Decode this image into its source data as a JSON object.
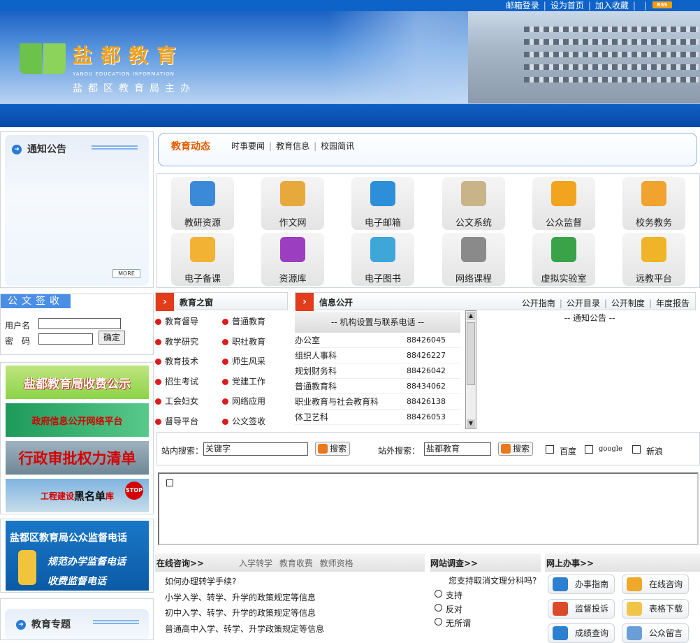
{
  "toplinks": {
    "mail_login": "邮箱登录",
    "set_home": "设为首页",
    "add_fav": "加入收藏",
    "rss": "RSS"
  },
  "header": {
    "title": "盐都教育",
    "subtitle_en": "YANDU EDUCATION INFORMATION",
    "subtitle": "盐都区教育局主办"
  },
  "notice": {
    "title": "通知公告",
    "more": "MORE"
  },
  "doc_receive": {
    "title": "公文签收",
    "username_label": "用户名",
    "password_label": "密　码",
    "submit": "确定"
  },
  "banners": {
    "fee": "盐都教育局收费公示",
    "gov_info": "政府信息公开网络平台",
    "admin": "行政审批权力清单",
    "blacklist_a": "工程建设",
    "blacklist_b": "黑名单",
    "blacklist_c": "库",
    "stop": "STOP"
  },
  "supervise": {
    "title": "盐都区教育局公众监督电话",
    "line1": "规范办学监督电话",
    "line2": "收费监督电话"
  },
  "topic": {
    "title": "教育专题"
  },
  "news": {
    "active": "教育动态",
    "tabs": [
      "时事要闻",
      "教育信息",
      "校园简讯"
    ]
  },
  "grid": [
    {
      "label": "教研资源",
      "icon": "books-icon",
      "color": "#3b8ad8"
    },
    {
      "label": "作文网",
      "icon": "pens-icon",
      "color": "#e8a93c"
    },
    {
      "label": "电子邮箱",
      "icon": "mail-icon",
      "color": "#2d8fd8"
    },
    {
      "label": "公文系统",
      "icon": "document-icon",
      "color": "#c9b48a"
    },
    {
      "label": "公众监督",
      "icon": "folders-icon",
      "color": "#f3a41f"
    },
    {
      "label": "校务教务",
      "icon": "pencil-icon",
      "color": "#f0a32e"
    },
    {
      "label": "电子备课",
      "icon": "notebook-icon",
      "color": "#f2b233"
    },
    {
      "label": "资源库",
      "icon": "cubes-icon",
      "color": "#9b3fc0"
    },
    {
      "label": "电子图书",
      "icon": "ebooks-icon",
      "color": "#3fa6d8"
    },
    {
      "label": "网络课程",
      "icon": "film-reel-icon",
      "color": "#8a8a8a"
    },
    {
      "label": "虚拟实验室",
      "icon": "people-icon",
      "color": "#3aa34a"
    },
    {
      "label": "远教平台",
      "icon": "users-icon",
      "color": "#f0b428"
    }
  ],
  "edu": {
    "title": "教育之窗",
    "items": [
      "教育督导",
      "普通教育",
      "教学研究",
      "职社教育",
      "教育技术",
      "师生风采",
      "招生考试",
      "党建工作",
      "工会妇女",
      "网络应用",
      "督导平台",
      "公文签收"
    ]
  },
  "info": {
    "title": "信息公开",
    "links": [
      "公开指南",
      "公开目录",
      "公开制度",
      "年度报告"
    ],
    "dept_head": "-- 机构设置与联系电话 --",
    "notice_head": "-- 通知公告 --",
    "depts": [
      {
        "name": "办公室",
        "phone": "88426045"
      },
      {
        "name": "组织人事科",
        "phone": "88426227"
      },
      {
        "name": "规划财务科",
        "phone": "88426042"
      },
      {
        "name": "普通教育科",
        "phone": "88434062"
      },
      {
        "name": "职业教育与社会教育科",
        "phone": "88426138"
      },
      {
        "name": "体卫艺科",
        "phone": "88426053"
      }
    ]
  },
  "search": {
    "inside_label": "站内搜索：",
    "inside_value": "关键字",
    "outside_label": "站外搜索：",
    "outside_value": "盐都教育",
    "button": "搜索",
    "engines": [
      "百度",
      "google",
      "新浪"
    ]
  },
  "consult": {
    "title": "在线咨询>>",
    "tabs": "入学转学 教育收费 教师资格",
    "items": [
      "如何办理转学手续?",
      "小学入学、转学、升学的政策规定等信息",
      "初中入学、转学、升学的政策规定等信息",
      "普通高中入学、转学、升学政策规定等信息"
    ]
  },
  "survey": {
    "title": "网站调查>>",
    "question": "您支持取消文理分科吗?",
    "options": [
      "支持",
      "反对",
      "无所谓"
    ]
  },
  "affairs": {
    "title": "网上办事>>",
    "buttons": [
      {
        "label": "办事指南",
        "color": "#2d7fd0"
      },
      {
        "label": "在线咨询",
        "color": "#f0a82a"
      },
      {
        "label": "监督投诉",
        "color": "#d94b2a"
      },
      {
        "label": "表格下载",
        "color": "#f1c54a"
      },
      {
        "label": "成绩查询",
        "color": "#2d7fd0"
      },
      {
        "label": "公众留言",
        "color": "#6a9fd6"
      }
    ]
  }
}
